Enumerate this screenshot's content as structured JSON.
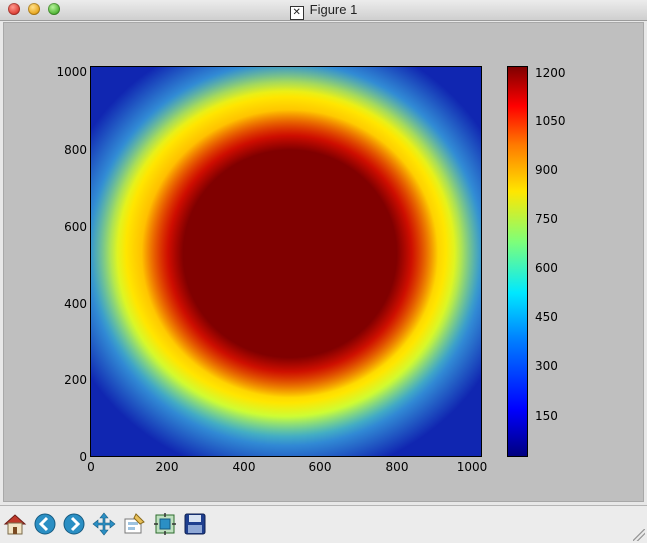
{
  "window": {
    "title": "Figure 1"
  },
  "colors": {
    "figure_bg": "#bfbfbf",
    "toolbar_bg": "#ececec"
  },
  "axes": {
    "y_ticks": [
      "1000",
      "800",
      "600",
      "400",
      "200",
      "0"
    ],
    "x_ticks": [
      "0",
      "200",
      "400",
      "600",
      "800",
      "1000"
    ]
  },
  "colorbar": {
    "ticks": [
      "1200",
      "1050",
      "900",
      "750",
      "600",
      "450",
      "300",
      "150"
    ]
  },
  "toolbar": {
    "buttons": [
      {
        "name": "home-button",
        "icon": "home-icon"
      },
      {
        "name": "back-button",
        "icon": "arrow-left-icon"
      },
      {
        "name": "forward-button",
        "icon": "arrow-right-icon"
      },
      {
        "name": "pan-button",
        "icon": "move-icon"
      },
      {
        "name": "zoom-button",
        "icon": "zoom-rect-icon"
      },
      {
        "name": "subplots-button",
        "icon": "subplots-icon"
      },
      {
        "name": "save-button",
        "icon": "floppy-disk-icon"
      }
    ]
  }
}
